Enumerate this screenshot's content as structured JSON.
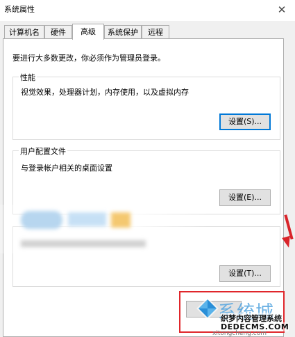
{
  "window": {
    "title": "系统属性",
    "close_icon": "close-icon"
  },
  "tabs": [
    {
      "label": "计算机名"
    },
    {
      "label": "硬件"
    },
    {
      "label": "高级"
    },
    {
      "label": "系统保护"
    },
    {
      "label": "远程"
    }
  ],
  "advanced": {
    "admin_note": "要进行大多数更改，你必须作为管理员登录。",
    "performance": {
      "label": "性能",
      "description": "视觉效果，处理器计划，内存使用，以及虚拟内存",
      "settings_button": "设置(S)..."
    },
    "user_profiles": {
      "label": "用户配置文件",
      "description": "与登录帐户相关的桌面设置",
      "settings_button": "设置(E)..."
    },
    "startup_recovery": {
      "settings_button": "设置(T)..."
    }
  },
  "watermark": {
    "brand": "系统城",
    "line1": "织梦内容管理系统",
    "line2": "DEDECMS.COM",
    "url": "xitongcheng.com"
  },
  "colors": {
    "highlight_box": "#e0262b",
    "accent": "#0078d7"
  }
}
